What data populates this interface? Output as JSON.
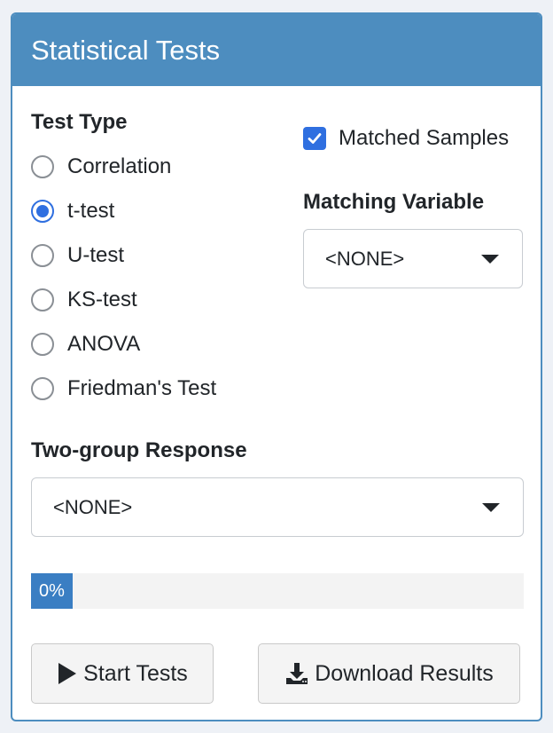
{
  "panel": {
    "title": "Statistical Tests"
  },
  "test_type": {
    "label": "Test Type",
    "options": [
      "Correlation",
      "t-test",
      "U-test",
      "KS-test",
      "ANOVA",
      "Friedman's Test"
    ],
    "selected": "t-test"
  },
  "matched_samples": {
    "label": "Matched Samples",
    "checked": true
  },
  "matching_variable": {
    "label": "Matching Variable",
    "value": "<NONE>"
  },
  "two_group_response": {
    "label": "Two-group Response",
    "value": "<NONE>"
  },
  "progress": {
    "label": "0%",
    "fraction": 0
  },
  "actions": {
    "start_label": "Start Tests",
    "download_label": "Download Results"
  },
  "icons": {
    "start": "play-icon",
    "download": "download-icon",
    "checkbox": "checkmark-icon",
    "dropdown": "caret-down-icon"
  },
  "colors": {
    "header": "#4d8dbf",
    "accent": "#2f6fe0",
    "progress": "#3a7ec3"
  }
}
